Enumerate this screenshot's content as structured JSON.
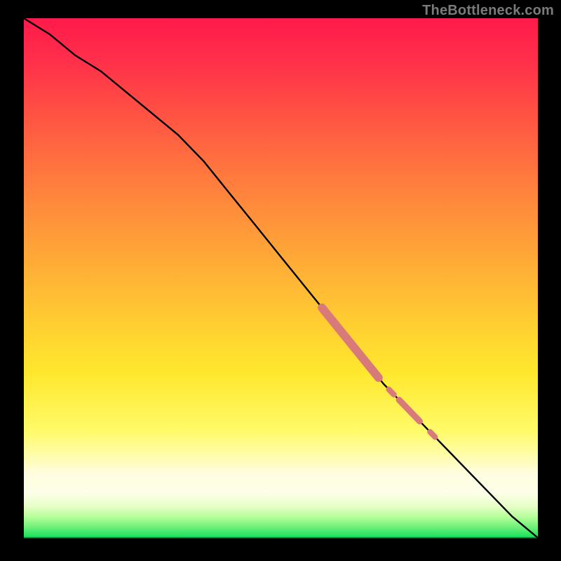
{
  "watermark": "TheBottleneck.com",
  "chart_data": {
    "type": "line",
    "title": "",
    "xlabel": "",
    "ylabel": "",
    "xlim": [
      0,
      100
    ],
    "ylim": [
      0,
      100
    ],
    "grid": false,
    "legend": false,
    "series": [
      {
        "name": "curve",
        "color": "#000000",
        "x": [
          0,
          5,
          10,
          15,
          20,
          25,
          30,
          35,
          40,
          45,
          50,
          55,
          60,
          65,
          70,
          75,
          80,
          85,
          90,
          95,
          100
        ],
        "y": [
          100,
          97,
          93,
          90,
          86,
          82,
          78,
          73,
          67,
          61,
          55,
          49,
          43,
          37,
          31,
          26,
          21,
          16,
          11,
          6,
          2
        ]
      }
    ],
    "highlights": [
      {
        "name": "segment-a",
        "x_start": 58,
        "x_end": 69,
        "thickness": "thick",
        "color": "#d97a7a"
      },
      {
        "name": "dot-a",
        "x_start": 71,
        "x_end": 72,
        "thickness": "dot",
        "color": "#d97a7a"
      },
      {
        "name": "segment-b",
        "x_start": 73,
        "x_end": 77,
        "thickness": "medium",
        "color": "#d97a7a"
      },
      {
        "name": "dot-b",
        "x_start": 79,
        "x_end": 80,
        "thickness": "dot",
        "color": "#d97a7a"
      }
    ],
    "background_gradient": {
      "top": "#ff1a4b",
      "mid_upper": "#ff8a3c",
      "mid": "#ffe82e",
      "pale_band": "#fdffe8",
      "green": "#18e45d"
    }
  }
}
